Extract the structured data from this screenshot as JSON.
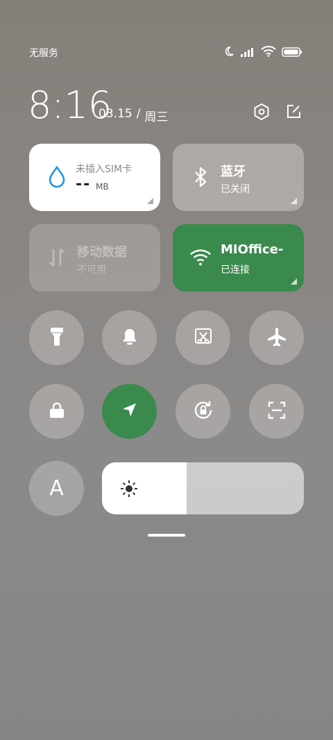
{
  "status_bar": {
    "carrier": "无服务",
    "icons": [
      "moon-icon",
      "signal-icon",
      "wifi-icon",
      "battery-icon"
    ]
  },
  "header": {
    "time": "8:16",
    "date": "03.15",
    "separator": "/",
    "weekday": "周三",
    "settings_icon": "hexagon-gear-icon",
    "edit_icon": "edit-icon"
  },
  "tiles": {
    "data_usage": {
      "title": "未插入SIM卡",
      "value": "--",
      "unit": "MB",
      "icon": "water-drop-icon"
    },
    "bluetooth": {
      "title": "蓝牙",
      "subtitle": "已关闭",
      "icon": "bluetooth-icon"
    },
    "mobile_data": {
      "title": "移动数据",
      "subtitle": "不可用",
      "icon": "data-arrows-icon"
    },
    "wifi": {
      "title": "MIOffice-",
      "subtitle": "已连接",
      "icon": "wifi-icon"
    }
  },
  "toggles_row1": [
    "flashlight-icon",
    "bell-icon",
    "screenshot-icon",
    "airplane-icon"
  ],
  "toggles_row2": [
    "lock-icon",
    "location-icon",
    "rotation-lock-icon",
    "scan-icon"
  ],
  "auto_brightness_label": "A",
  "brightness": {
    "level": 0.42
  },
  "colors": {
    "accent_green": "#3a8a4e",
    "drop_blue": "#1e96e6"
  }
}
